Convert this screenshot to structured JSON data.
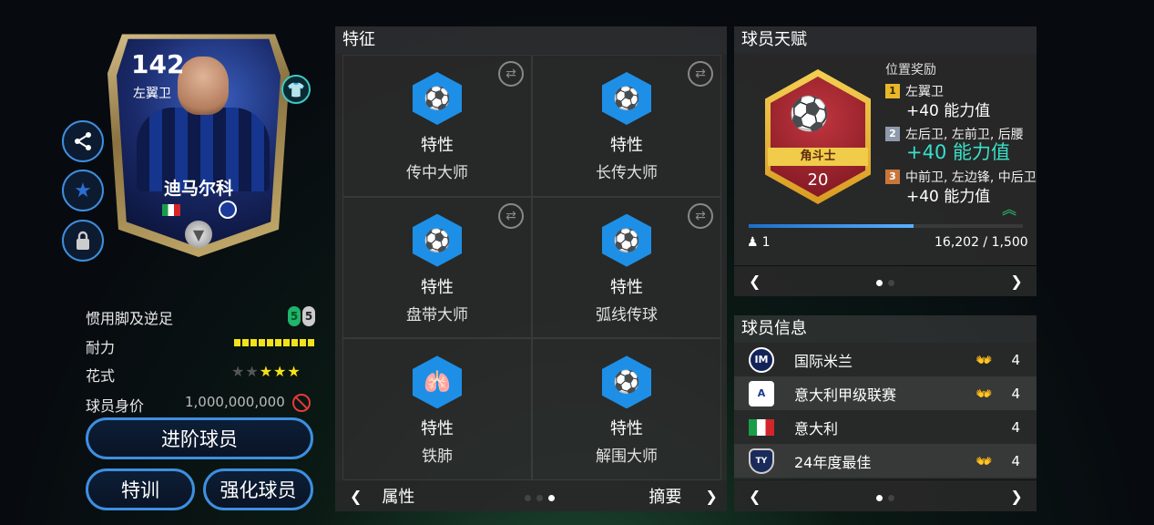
{
  "card": {
    "rating": "142",
    "position": "左翼卫",
    "name": "迪马尔科"
  },
  "attributes": {
    "foot_label": "惯用脚及逆足",
    "foot_left": "5",
    "foot_right": "5",
    "stamina_label": "耐力",
    "stamina_level": 10,
    "skill_label": "花式",
    "skill_stars": 3,
    "skill_max": 5,
    "value_label": "球员身价",
    "value": "1,000,000,000"
  },
  "buttons": {
    "promote": "进阶球员",
    "training": "特训",
    "enhance": "强化球员"
  },
  "traits": {
    "title": "特征",
    "items": [
      {
        "type": "特性",
        "name": "传中大师",
        "icon": "cross-ball-icon"
      },
      {
        "type": "特性",
        "name": "长传大师",
        "icon": "long-pass-icon"
      },
      {
        "type": "特性",
        "name": "盘带大师",
        "icon": "dribble-icon"
      },
      {
        "type": "特性",
        "name": "弧线传球",
        "icon": "curve-pass-icon"
      },
      {
        "type": "特性",
        "name": "铁肺",
        "icon": "lungs-icon"
      },
      {
        "type": "特性",
        "name": "解围大师",
        "icon": "clearance-icon"
      }
    ],
    "footer_left": "属性",
    "footer_right": "摘要"
  },
  "talent": {
    "title": "球员天赋",
    "badge_name": "角斗士",
    "badge_level": "20",
    "bonus_title": "位置奖励",
    "bonuses": [
      {
        "rank": "1",
        "positions": "左翼卫",
        "value": "+40 能力值"
      },
      {
        "rank": "2",
        "positions": "左后卫, 左前卫, 后腰",
        "value": "+40 能力值"
      },
      {
        "rank": "3",
        "positions": "中前卫, 左边锋, 中后卫",
        "value": "+40 能力值"
      }
    ],
    "count": "1",
    "progress_text": "16,202 / 1,500",
    "progress_fraction": 0.6,
    "colors": {
      "rank1": "#e8b82a",
      "rank2": "#8e9aab",
      "rank3": "#c9763a"
    }
  },
  "info": {
    "title": "球员信息",
    "rows": [
      {
        "name": "国际米兰",
        "rating": "4",
        "icon": "inter-crest-icon",
        "glove": true
      },
      {
        "name": "意大利甲级联赛",
        "rating": "4",
        "icon": "serie-a-icon",
        "glove": true
      },
      {
        "name": "意大利",
        "rating": "4",
        "icon": "italy-flag-icon",
        "glove": false
      },
      {
        "name": "24年度最佳",
        "rating": "4",
        "icon": "toty-icon",
        "glove": true
      }
    ]
  }
}
